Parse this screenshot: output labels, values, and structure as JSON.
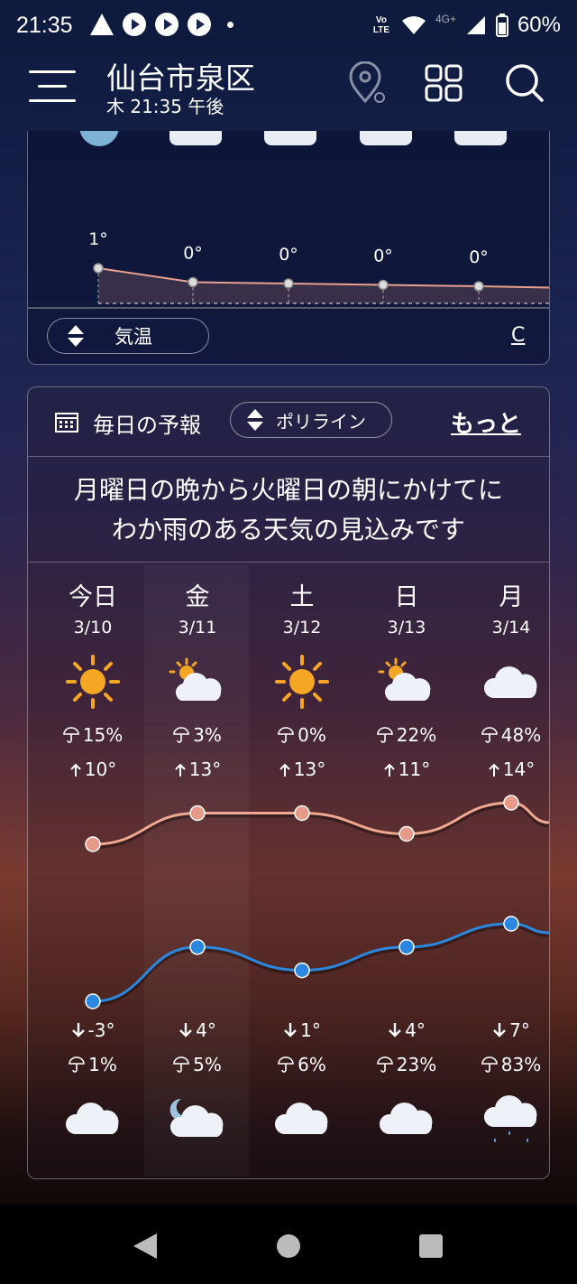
{
  "status_bar": {
    "time": "21:35",
    "network": "4G+",
    "volte": "Vo LTE",
    "battery": "60%"
  },
  "header": {
    "city": "仙台市泉区",
    "subtitle": "木 21:35 午後"
  },
  "hourly": {
    "temps": [
      "1°",
      "0°",
      "0°",
      "0°",
      "0°"
    ],
    "values": [
      1,
      0,
      0,
      0,
      0
    ],
    "selector_label": "気温",
    "unit_link": "C"
  },
  "daily": {
    "title": "毎日の予報",
    "view_selector": "ポリライン",
    "more_link": "もっと",
    "summary_line1": "月曜日の晩から火曜日の朝にかけてに",
    "summary_line2": "わか雨のある天気の見込みです",
    "days": [
      {
        "name": "今日",
        "date": "3/10",
        "day_icon": "sun-icon",
        "day_rain": "15%",
        "high": "10°",
        "low": "-3°",
        "night_rain": "1%",
        "night_icon": "cloud-icon"
      },
      {
        "name": "金",
        "date": "3/11",
        "day_icon": "partly-cloudy-icon",
        "day_rain": "3%",
        "high": "13°",
        "low": "4°",
        "night_rain": "5%",
        "night_icon": "cloudy-night-icon"
      },
      {
        "name": "土",
        "date": "3/12",
        "day_icon": "sun-icon",
        "day_rain": "0%",
        "high": "13°",
        "low": "1°",
        "night_rain": "6%",
        "night_icon": "cloud-icon"
      },
      {
        "name": "日",
        "date": "3/13",
        "day_icon": "partly-cloudy-icon",
        "day_rain": "22%",
        "high": "11°",
        "low": "4°",
        "night_rain": "23%",
        "night_icon": "cloud-icon"
      },
      {
        "name": "月",
        "date": "3/14",
        "day_icon": "cloud-icon",
        "day_rain": "48%",
        "high": "14°",
        "low": "7°",
        "night_rain": "83%",
        "night_icon": "rain-icon"
      }
    ],
    "high_values": [
      10,
      13,
      13,
      11,
      14
    ],
    "low_values": [
      -3,
      4,
      1,
      4,
      7
    ]
  }
}
